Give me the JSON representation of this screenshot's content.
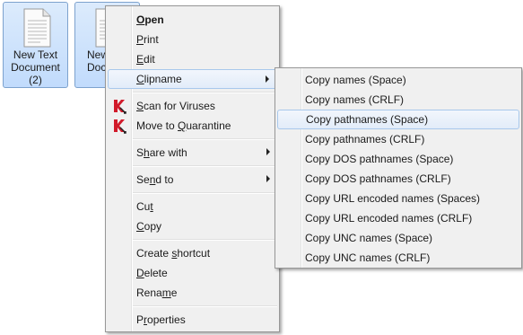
{
  "desktop": {
    "files": [
      {
        "label_lines": [
          "New Text",
          "Document",
          "(2)"
        ]
      },
      {
        "label_lines": [
          "New",
          "Docu"
        ]
      }
    ]
  },
  "context_menu": {
    "items": [
      {
        "label": "Open",
        "key": "O",
        "bold": true
      },
      {
        "label": "Print",
        "key": "P"
      },
      {
        "label": "Edit",
        "key": "E"
      },
      {
        "label": "Clipname",
        "key": "C",
        "submenu": true,
        "highlighted": true
      },
      {
        "label": "Scan for Viruses",
        "key": "S",
        "icon": "kaspersky-k-icon"
      },
      {
        "label": "Move to Quarantine",
        "key": "Q",
        "icon": "kaspersky-k-icon"
      },
      {
        "label": "Share with",
        "key": "h",
        "submenu": true
      },
      {
        "label": "Send to",
        "key": "n",
        "submenu": true
      },
      {
        "label": "Cut",
        "key": "t"
      },
      {
        "label": "Copy",
        "key": "C"
      },
      {
        "label": "Create shortcut",
        "key": "s"
      },
      {
        "label": "Delete",
        "key": "D"
      },
      {
        "label": "Rename",
        "key": "m"
      },
      {
        "label": "Properties",
        "key": "r"
      }
    ]
  },
  "clipname_submenu": {
    "items": [
      "Copy names (Space)",
      "Copy names (CRLF)",
      "Copy pathnames (Space)",
      "Copy pathnames (CRLF)",
      "Copy DOS pathnames (Space)",
      "Copy DOS pathnames (CRLF)",
      "Copy URL encoded names (Spaces)",
      "Copy URL encoded names (CRLF)",
      "Copy UNC names (Space)",
      "Copy UNC names (CRLF)"
    ],
    "highlighted_index": 2
  },
  "colors": {
    "selection_border": "#a8c8ec",
    "file_selected_bg": "#c1dbfc",
    "menu_bg": "#f0f0f0"
  }
}
